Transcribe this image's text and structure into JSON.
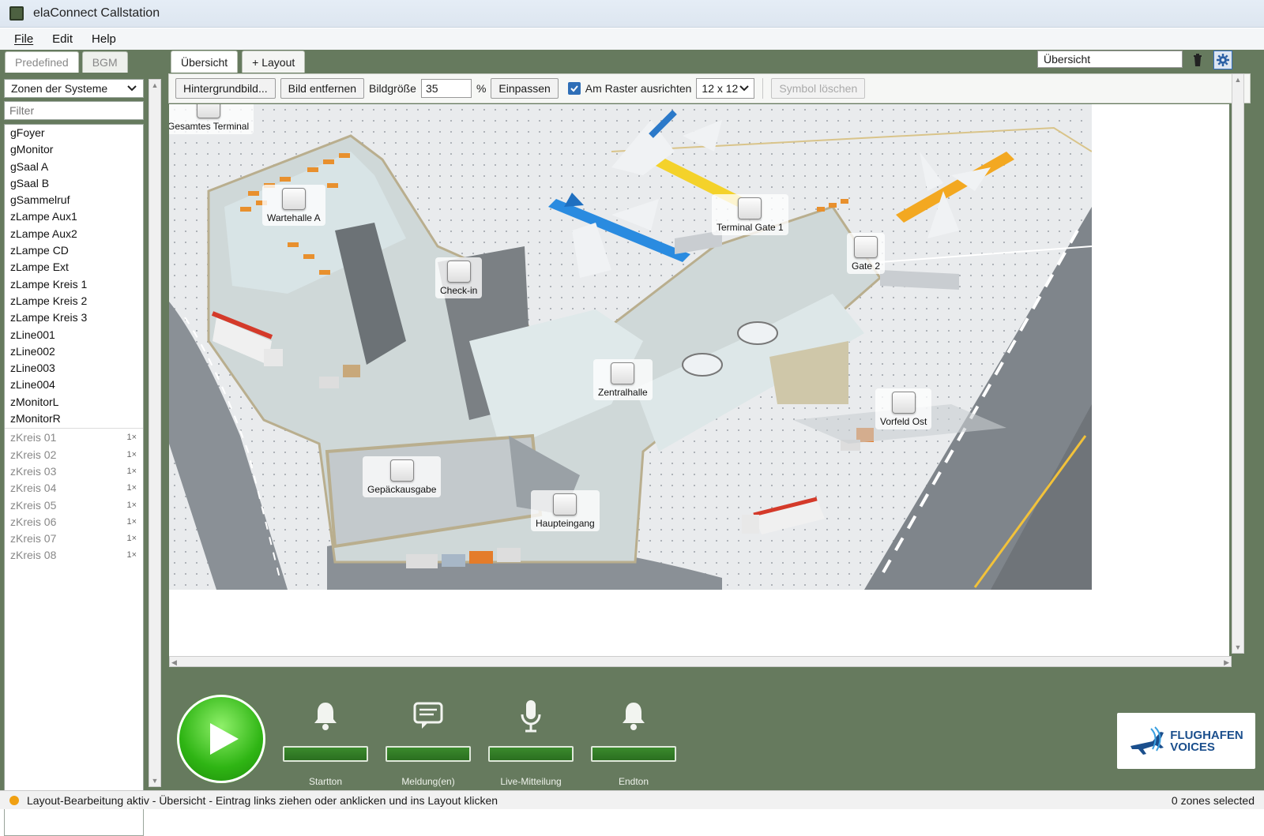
{
  "window": {
    "title": "elaConnect Callstation"
  },
  "menu": {
    "items": [
      "File",
      "Edit",
      "Help"
    ]
  },
  "left_panel": {
    "tabs": [
      "Predefined",
      "BGM"
    ],
    "zone_select": "Zonen der Systeme",
    "filter_placeholder": "Filter",
    "zones": [
      "gFoyer",
      "gMonitor",
      "gSaal A",
      "gSaal B",
      "gSammelruf",
      "zLampe Aux1",
      "zLampe Aux2",
      "zLampe CD",
      "zLampe Ext",
      "zLampe Kreis 1",
      "zLampe Kreis 2",
      "zLampe Kreis 3",
      "zLine001",
      "zLine002",
      "zLine003",
      "zLine004",
      "zMonitorL",
      "zMonitorR"
    ],
    "groups": [
      {
        "name": "zKreis 01",
        "count": "1×"
      },
      {
        "name": "zKreis 02",
        "count": "1×"
      },
      {
        "name": "zKreis 03",
        "count": "1×"
      },
      {
        "name": "zKreis 04",
        "count": "1×"
      },
      {
        "name": "zKreis 05",
        "count": "1×"
      },
      {
        "name": "zKreis 06",
        "count": "1×"
      },
      {
        "name": "zKreis 07",
        "count": "1×"
      },
      {
        "name": "zKreis 08",
        "count": "1×"
      }
    ]
  },
  "main": {
    "tabs": [
      "Übersicht",
      "+ Layout"
    ],
    "layout_name": "Übersicht",
    "toolbar": {
      "background_button": "Hintergrundbild...",
      "remove_image_button": "Bild entfernen",
      "image_size_label": "Bildgröße",
      "image_size_value": "35",
      "percent": "%",
      "fit_button": "Einpassen",
      "snap_label": "Am Raster ausrichten",
      "grid_value": "12 x 12",
      "delete_symbol_button": "Symbol löschen"
    },
    "markers": {
      "gesamtes_terminal": "Gesamtes Terminal",
      "wartehalle_a": "Wartehalle A",
      "check_in": "Check-in",
      "terminal_gate_1": "Terminal Gate 1",
      "gate_2": "Gate 2",
      "zentralhalle": "Zentralhalle",
      "vorfeld_ost": "Vorfeld Ost",
      "gepaeckausgabe": "Gepäckausgabe",
      "haupteingang": "Haupteingang"
    }
  },
  "bottom": {
    "actions": [
      {
        "label": "Startton",
        "icon": "bell-icon"
      },
      {
        "label": "Meldung(en)",
        "icon": "message-icon"
      },
      {
        "label": "Live-Mitteilung",
        "icon": "microphone-icon"
      },
      {
        "label": "Endton",
        "icon": "bell-icon"
      }
    ],
    "logo": {
      "line1": "FLUGHAFEN",
      "line2": "VOICES"
    }
  },
  "status": {
    "message": "Layout-Bearbeitung aktiv - Übersicht - Eintrag links ziehen oder anklicken und ins Layout klicken",
    "selection": "0 zones selected"
  },
  "colors": {
    "panel_green": "#667a5e",
    "accent_blue": "#2f6fb7",
    "play_green": "#2fb514",
    "status_orange": "#f0a012"
  }
}
